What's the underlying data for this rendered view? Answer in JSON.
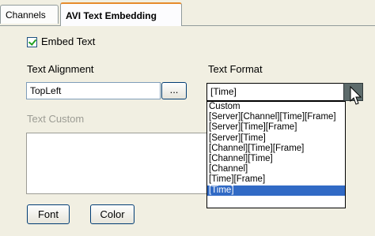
{
  "tabs": {
    "channels": "Channels",
    "avi_text_embedding": "AVI Text Embedding"
  },
  "embed_text": {
    "label": "Embed Text",
    "checked": true
  },
  "text_alignment": {
    "label": "Text Alignment",
    "value": "TopLeft",
    "browse_label": "..."
  },
  "text_format": {
    "label": "Text Format",
    "value": "[Time]",
    "browse_label": "...",
    "options": [
      "Custom",
      "[Server][Channel][Time][Frame]",
      "[Server][Time][Frame]",
      "[Server][Time]",
      "[Channel][Time][Frame]",
      "[Channel][Time]",
      "[Channel]",
      "[Time][Frame]",
      "[Time]"
    ],
    "selected_option": "[Time]"
  },
  "text_custom": {
    "label": "Text Custom",
    "value": ""
  },
  "buttons": {
    "font": "Font",
    "color": "Color"
  },
  "colors": {
    "selection": "#316ac5",
    "active_tab_accent": "#e68b2c"
  }
}
